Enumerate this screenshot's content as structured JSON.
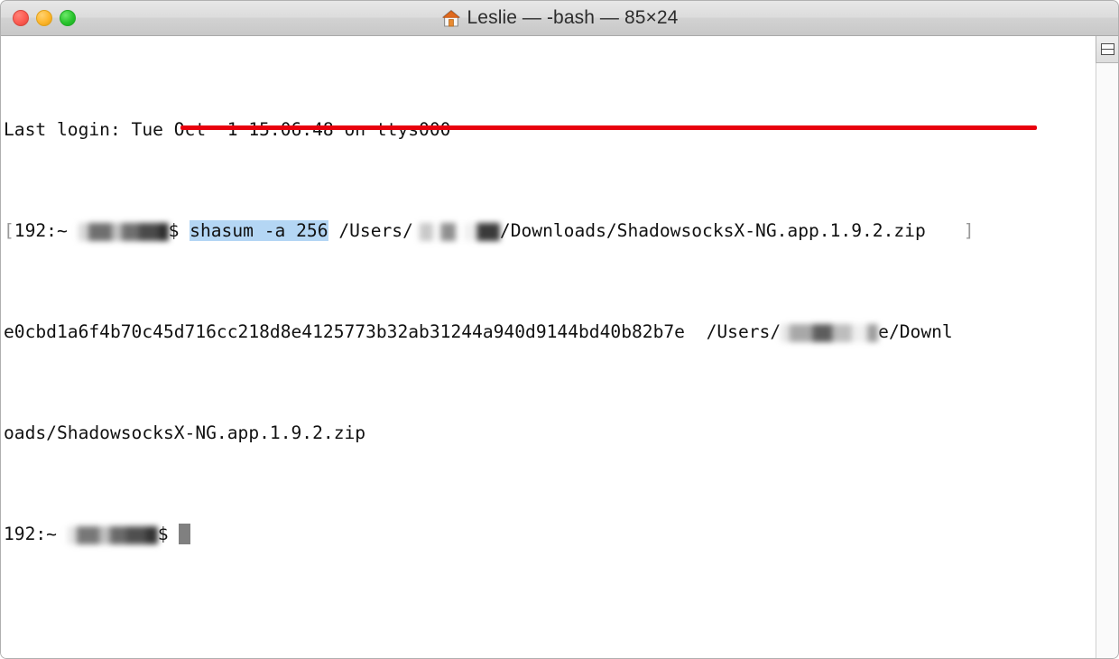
{
  "window": {
    "title": "Leslie — -bash — 85×24",
    "home_icon": "home-icon",
    "traffic_lights": [
      {
        "name": "close",
        "color": "#fc5b51"
      },
      {
        "name": "minimize",
        "color": "#fdb62c"
      },
      {
        "name": "maximize",
        "color": "#2ac42e"
      }
    ]
  },
  "terminal": {
    "cols": 85,
    "rows": 24,
    "shell": "-bash",
    "profile_name": "Leslie",
    "lines": {
      "last_login": "Last login: Tue Oct  1 15:06:48 on ttys000",
      "prompt_open_bracket": "[",
      "prompt_host": "192:~ ",
      "prompt_symbol": "$ ",
      "command_selected": "shasum -a 256",
      "command_path_prefix": " /Users/",
      "command_path_suffix": "/Downloads/ShadowsocksX-NG.app.1.9.2.zip",
      "line_end_bracket": "]",
      "hash_value": "e0cbd1a6f4b70c45d716cc218d8e4125773b32ab31244a940d9144bd40b82b7e",
      "hash_path_prefix": "  /Users/",
      "hash_path_mid": "e/Downl",
      "hash_path_wrap": "oads/ShadowsocksX-NG.app.1.9.2.zip",
      "final_prompt_host": "192:~ ",
      "final_prompt_symbol": "$ "
    },
    "selection_color": "#b4d6f4",
    "annotation_color": "#e8000d",
    "cursor_color": "#808080",
    "foreground": "#111111",
    "background": "#ffffff"
  },
  "controls": {
    "split_pane_icon": "split-pane-icon"
  }
}
